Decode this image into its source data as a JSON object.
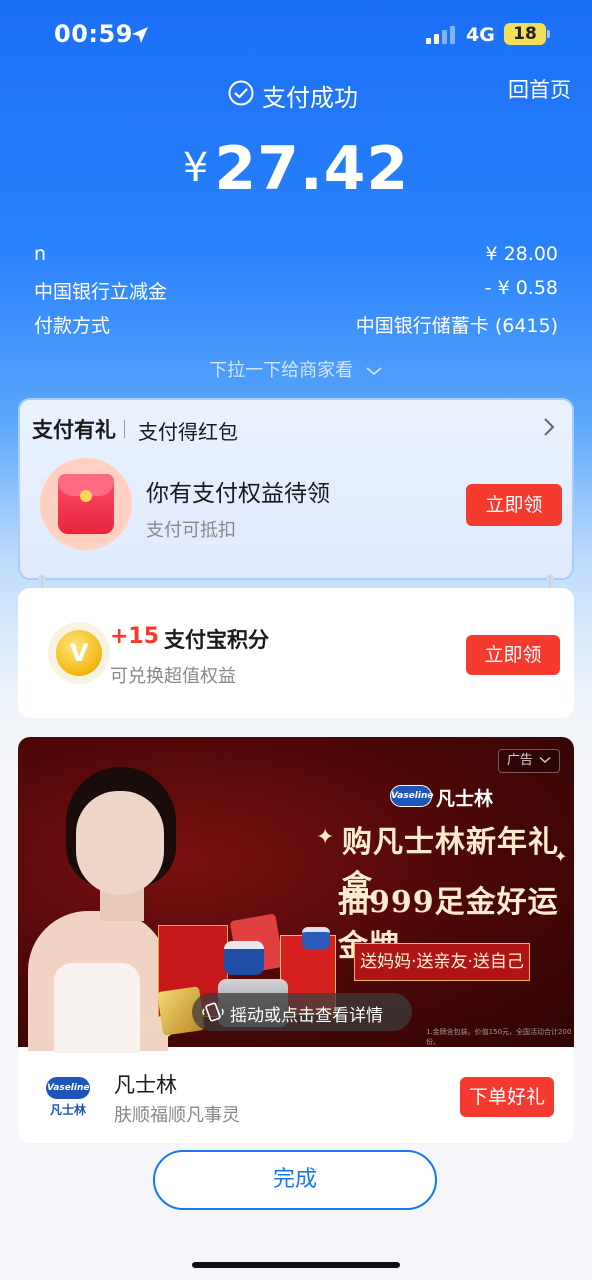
{
  "status_bar": {
    "time": "00:59",
    "network": "4G",
    "battery": "18",
    "icons": [
      "location-arrow-icon",
      "signal-icon"
    ]
  },
  "header": {
    "status_text": "支付成功",
    "home_link": "回首页",
    "currency": "¥",
    "amount": "27.42"
  },
  "details": [
    {
      "label": "n",
      "value": "¥ 28.00"
    },
    {
      "label": "中国银行立减金",
      "value": "- ¥ 0.58"
    },
    {
      "label": "付款方式",
      "value": "中国银行储蓄卡 (6415)"
    }
  ],
  "pull_hint": "下拉一下给商家看",
  "reward_card": {
    "title": "支付有礼",
    "subtitle": "支付得红包",
    "main_text": "你有支付权益待领",
    "sub_text": "支付可抵扣",
    "button": "立即领"
  },
  "points_card": {
    "points": "+15",
    "label": "支付宝积分",
    "sub_text": "可兑换超值权益",
    "button": "立即领",
    "coin_glyph": "V"
  },
  "ad": {
    "tag": "广告",
    "brand_en": "Vaseline",
    "brand_cn": "凡士林",
    "headline1": "购凡士林新年礼盒",
    "headline2": "抽999足金好运金牌",
    "banner": "送妈妈·送亲友·送自己",
    "shake_text": "摇动或点击查看详情",
    "fine_print": "1.金牌含包装。价值150元，全国活动合计200份。",
    "title": "凡士林",
    "desc": "肤顺福顺凡事灵",
    "button": "下单好礼"
  },
  "done_button": "完成",
  "colors": {
    "accent_blue": "#1a77f2",
    "red_button": "#f53a2f",
    "points_red": "#f5382b"
  }
}
